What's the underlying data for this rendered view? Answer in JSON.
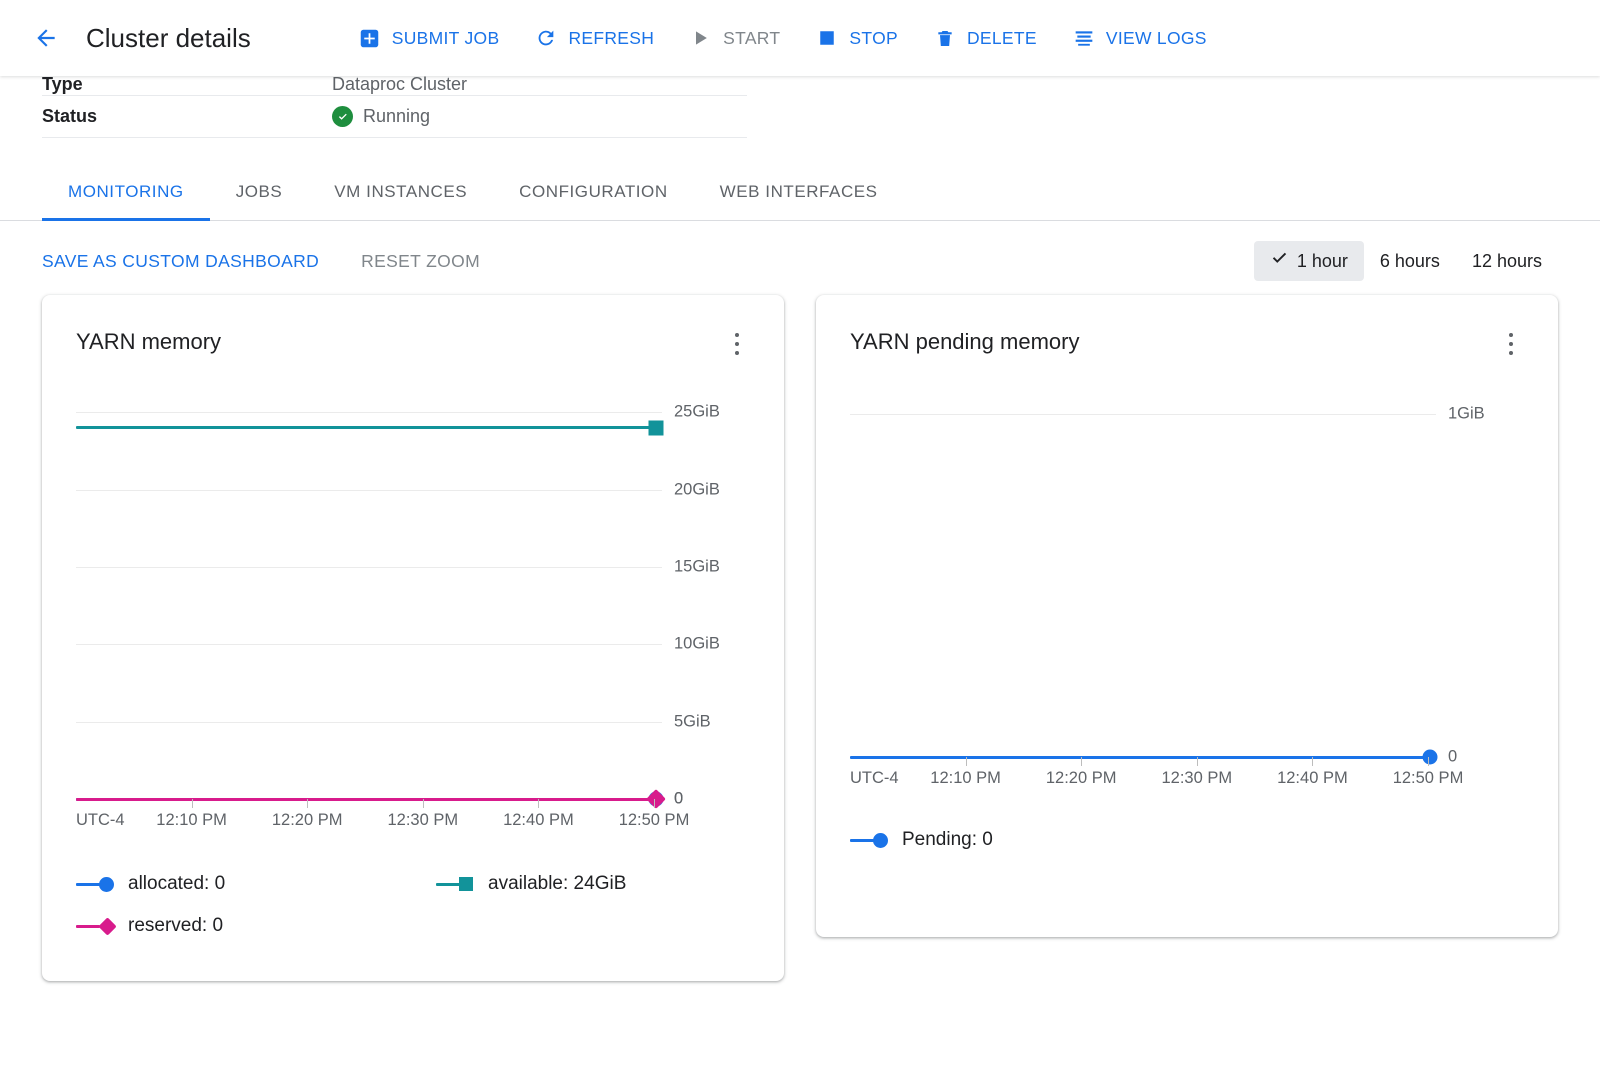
{
  "header": {
    "back_icon": "arrow-left-icon",
    "title": "Cluster details",
    "actions": [
      {
        "label": "SUBMIT JOB",
        "icon": "plus-box-icon",
        "disabled": false
      },
      {
        "label": "REFRESH",
        "icon": "refresh-icon",
        "disabled": false
      },
      {
        "label": "START",
        "icon": "play-icon",
        "disabled": true
      },
      {
        "label": "STOP",
        "icon": "stop-square-icon",
        "disabled": false
      },
      {
        "label": "DELETE",
        "icon": "trash-icon",
        "disabled": false
      },
      {
        "label": "VIEW LOGS",
        "icon": "logs-lines-icon",
        "disabled": false
      }
    ]
  },
  "details": {
    "type_key": "Type",
    "type_value": "Dataproc Cluster",
    "status_key": "Status",
    "status_value": "Running",
    "status_icon": "check-circle-icon",
    "status_color": "#1e8e3e"
  },
  "tabs": [
    {
      "label": "MONITORING",
      "active": true
    },
    {
      "label": "JOBS",
      "active": false
    },
    {
      "label": "VM INSTANCES",
      "active": false
    },
    {
      "label": "CONFIGURATION",
      "active": false
    },
    {
      "label": "WEB INTERFACES",
      "active": false
    }
  ],
  "controls": {
    "save_dashboard": "SAVE AS CUSTOM DASHBOARD",
    "reset_zoom": "RESET ZOOM",
    "ranges": [
      {
        "label": "1 hour",
        "selected": true
      },
      {
        "label": "6 hours",
        "selected": false
      },
      {
        "label": "12 hours",
        "selected": false
      }
    ],
    "check_icon": "check-icon"
  },
  "colors": {
    "accent": "#1a73e8",
    "allocated": "#1a73e8",
    "available": "#12939a",
    "reserved": "#d81b8c",
    "pending": "#1a73e8",
    "grid": "#ebebeb"
  },
  "cards": [
    {
      "title": "YARN memory",
      "menu_icon": "more-vert-icon"
    },
    {
      "title": "YARN pending memory",
      "menu_icon": "more-vert-icon"
    }
  ],
  "chart_data": [
    {
      "type": "line",
      "title": "YARN memory",
      "xlabel": "UTC-4",
      "ylabel": "",
      "grid": true,
      "legend_position": "bottom",
      "ylim": [
        0,
        26
      ],
      "yticks": [
        "0",
        "5GiB",
        "10GiB",
        "15GiB",
        "20GiB",
        "25GiB"
      ],
      "ytick_values": [
        0,
        5,
        10,
        15,
        20,
        25
      ],
      "xticks": [
        "UTC-4",
        "12:10 PM",
        "12:20 PM",
        "12:30 PM",
        "12:40 PM",
        "12:50 PM"
      ],
      "end_labels": [
        "0"
      ],
      "series": [
        {
          "name": "allocated",
          "value_label": "allocated: 0",
          "current": 0,
          "values": [
            0,
            0,
            0,
            0,
            0,
            0
          ],
          "color": "#1a73e8",
          "marker": "circle"
        },
        {
          "name": "available",
          "value_label": "available: 24GiB",
          "current": 24,
          "values": [
            24,
            24,
            24,
            24,
            24,
            24
          ],
          "color": "#12939a",
          "marker": "square"
        },
        {
          "name": "reserved",
          "value_label": "reserved: 0",
          "current": 0,
          "values": [
            0,
            0,
            0,
            0,
            0,
            0
          ],
          "color": "#d81b8c",
          "marker": "diamond"
        }
      ]
    },
    {
      "type": "line",
      "title": "YARN pending memory",
      "xlabel": "UTC-4",
      "ylabel": "",
      "grid": true,
      "legend_position": "bottom",
      "ylim": [
        0,
        1.05
      ],
      "yticks": [
        "1GiB"
      ],
      "ytick_values": [
        1
      ],
      "xticks": [
        "UTC-4",
        "12:10 PM",
        "12:20 PM",
        "12:30 PM",
        "12:40 PM",
        "12:50 PM"
      ],
      "end_labels": [
        "0"
      ],
      "series": [
        {
          "name": "Pending",
          "value_label": "Pending: 0",
          "current": 0,
          "values": [
            0,
            0,
            0,
            0,
            0,
            0
          ],
          "color": "#1a73e8",
          "marker": "circle"
        }
      ]
    }
  ]
}
